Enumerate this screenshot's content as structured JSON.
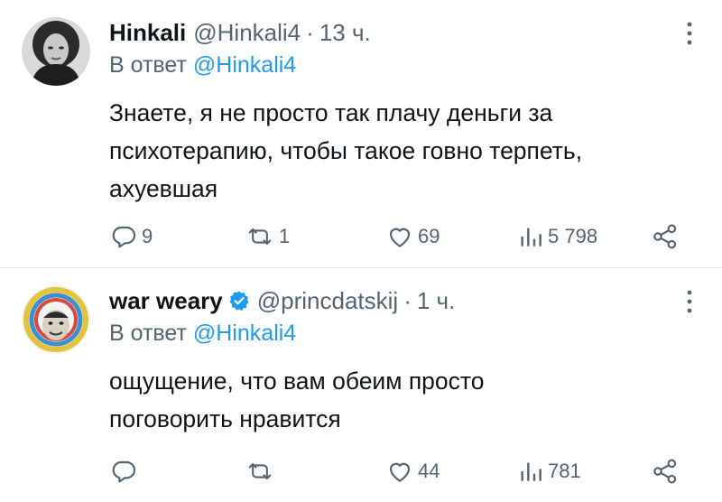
{
  "tweets": [
    {
      "name": "Hinkali",
      "handle": "@Hinkali4",
      "separator": "·",
      "time": "13 ч.",
      "reply_prefix": "В ответ ",
      "reply_mention": "@Hinkali4",
      "text": "Знаете, я не просто так плачу деньги за психотерапию, чтобы такое говно терпеть, ахуевшая",
      "replies": "9",
      "reposts": "1",
      "likes": "69",
      "views": "5 798",
      "verified": false
    },
    {
      "name": "war weary",
      "handle": "@princdatskij",
      "separator": "·",
      "time": "1 ч.",
      "reply_prefix": "В ответ ",
      "reply_mention": "@Hinkali4",
      "text": "ощущение, что вам обеим просто поговорить нравится",
      "replies": "",
      "reposts": "",
      "likes": "44",
      "views": "781",
      "verified": true
    }
  ],
  "colors": {
    "text": "#0f1419",
    "secondary": "#536471",
    "accent": "#1d9bf0",
    "divider": "#e1e5e9"
  },
  "icons": [
    "reply-icon",
    "repost-icon",
    "like-icon",
    "views-icon",
    "share-icon",
    "more-icon",
    "verified-icon"
  ]
}
